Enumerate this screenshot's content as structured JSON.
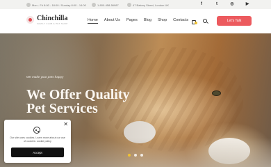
{
  "topbar": {
    "hours": "Mon - Fri 8:00 - 18:00 / Sunday 8:00 - 14:00",
    "phone": "1-800-458-56987",
    "address": "47 Bakery Street, London UK",
    "social_icons": [
      "facebook-icon",
      "twitter-icon",
      "instagram-icon",
      "youtube-icon"
    ],
    "social_glyphs": [
      "f",
      "t",
      "◎",
      "▶"
    ]
  },
  "header": {
    "brand": "Chinchilla",
    "tagline": "FAMILY CLUB & PET SHOP",
    "nav": [
      "Home",
      "About Us",
      "Pages",
      "Blog",
      "Shop",
      "Contacts"
    ],
    "active_nav": "Home",
    "cta_label": "Let's Talk",
    "icons": [
      "cart-icon",
      "search-icon"
    ]
  },
  "hero": {
    "kicker": "We make your pets happy",
    "headline": "We Offer Quality Pet Services",
    "slides": 3,
    "active_slide": 1
  },
  "cookie": {
    "text": "Our site uses cookies. Learn more about our use of cookies: cookie policy",
    "accept_label": "Accept"
  },
  "colors": {
    "accent": "#ec5a5e",
    "badge": "#f1c232",
    "topbar_bg": "#f2f2f0",
    "button_dark": "#111111"
  }
}
